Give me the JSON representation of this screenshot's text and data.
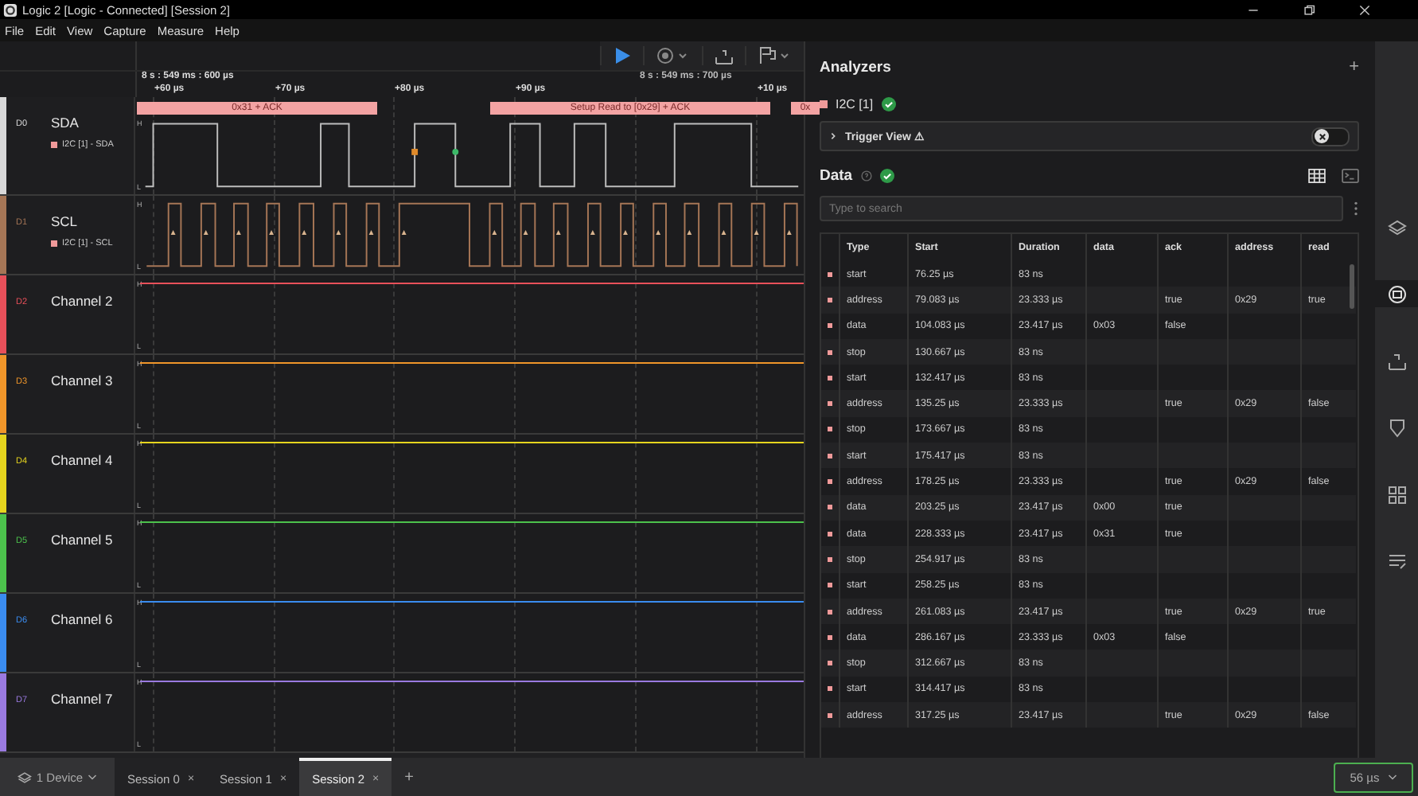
{
  "window": {
    "title": "Logic 2 [Logic - Connected] [Session 2]"
  },
  "menu": [
    "File",
    "Edit",
    "View",
    "Capture",
    "Measure",
    "Help"
  ],
  "timeline": {
    "origins": [
      "8 s : 549 ms : 600 µs",
      "8 s : 549 ms : 700 µs"
    ],
    "ticks": [
      "+60 µs",
      "+70 µs",
      "+80 µs",
      "+90 µs",
      "+10 µs"
    ]
  },
  "annotations": [
    "0x31 + ACK",
    "Setup Read to [0x29] + ACK",
    "0x"
  ],
  "channels": [
    {
      "id": "D0",
      "name": "SDA",
      "color": "#d8d8d8",
      "analyzer": "I2C [1] - SDA",
      "kind": "sda",
      "high": "H",
      "low": "L"
    },
    {
      "id": "D1",
      "name": "SCL",
      "color": "#a67656",
      "analyzer": "I2C [1] - SCL",
      "kind": "scl",
      "high": "H",
      "low": "L"
    },
    {
      "id": "D2",
      "name": "Channel 2",
      "color": "#e8505a",
      "kind": "flat",
      "high": "H",
      "low": "L"
    },
    {
      "id": "D3",
      "name": "Channel 3",
      "color": "#f0962a",
      "kind": "flat",
      "high": "H",
      "low": "L"
    },
    {
      "id": "D4",
      "name": "Channel 4",
      "color": "#e6d41e",
      "kind": "flat",
      "high": "H",
      "low": "L"
    },
    {
      "id": "D5",
      "name": "Channel 5",
      "color": "#4cc24c",
      "kind": "flat",
      "high": "H",
      "low": "L"
    },
    {
      "id": "D6",
      "name": "Channel 6",
      "color": "#3a8cf0",
      "kind": "flat",
      "high": "H",
      "low": "L"
    },
    {
      "id": "D7",
      "name": "Channel 7",
      "color": "#9a7ae0",
      "kind": "flat",
      "high": "H",
      "low": "L"
    }
  ],
  "analyzers": {
    "title": "Analyzers",
    "add": "+",
    "items": [
      {
        "name": "I2C [1]",
        "color": "#f09a9a",
        "ok": true
      }
    ],
    "trigger_view": {
      "label": "Trigger View ⚠",
      "on": false
    }
  },
  "data": {
    "title": "Data",
    "ok": true,
    "search": {
      "placeholder": "Type to search"
    },
    "columns": [
      "Type",
      "Start",
      "Duration",
      "data",
      "ack",
      "address",
      "read"
    ],
    "rows": [
      [
        "start",
        "76.25 µs",
        "83 ns",
        null,
        null,
        null,
        null
      ],
      [
        "address",
        "79.083 µs",
        "23.333 µs",
        null,
        "true",
        "0x29",
        "true"
      ],
      [
        "data",
        "104.083 µs",
        "23.417 µs",
        "0x03",
        "false",
        null,
        null
      ],
      [
        "stop",
        "130.667 µs",
        "83 ns",
        null,
        null,
        null,
        null
      ],
      [
        "start",
        "132.417 µs",
        "83 ns",
        null,
        null,
        null,
        null
      ],
      [
        "address",
        "135.25 µs",
        "23.333 µs",
        null,
        "true",
        "0x29",
        "false"
      ],
      [
        "stop",
        "173.667 µs",
        "83 ns",
        null,
        null,
        null,
        null
      ],
      [
        "start",
        "175.417 µs",
        "83 ns",
        null,
        null,
        null,
        null
      ],
      [
        "address",
        "178.25 µs",
        "23.333 µs",
        null,
        "true",
        "0x29",
        "false"
      ],
      [
        "data",
        "203.25 µs",
        "23.417 µs",
        "0x00",
        "true",
        null,
        null
      ],
      [
        "data",
        "228.333 µs",
        "23.417 µs",
        "0x31",
        "true",
        null,
        null
      ],
      [
        "stop",
        "254.917 µs",
        "83 ns",
        null,
        null,
        null,
        null
      ],
      [
        "start",
        "258.25 µs",
        "83 ns",
        null,
        null,
        null,
        null
      ],
      [
        "address",
        "261.083 µs",
        "23.417 µs",
        null,
        "true",
        "0x29",
        "true"
      ],
      [
        "data",
        "286.167 µs",
        "23.333 µs",
        "0x03",
        "false",
        null,
        null
      ],
      [
        "stop",
        "312.667 µs",
        "83 ns",
        null,
        null,
        null,
        null
      ],
      [
        "start",
        "314.417 µs",
        "83 ns",
        null,
        null,
        null,
        null
      ],
      [
        "address",
        "317.25 µs",
        "23.417 µs",
        null,
        "true",
        "0x29",
        "false"
      ]
    ]
  },
  "side_icons": [
    {
      "kind": "layers",
      "selected": false
    },
    {
      "kind": "analyzer",
      "selected": true
    },
    {
      "kind": "measure",
      "selected": false
    },
    {
      "kind": "marker",
      "selected": false
    },
    {
      "kind": "extensions",
      "selected": false
    },
    {
      "kind": "notes",
      "selected": false
    }
  ],
  "device": "1 Device",
  "tabs": [
    {
      "label": "Session 0",
      "close": "×",
      "selected": false
    },
    {
      "label": "Session 1",
      "close": "×",
      "selected": false
    },
    {
      "label": "Session 2",
      "close": "×",
      "selected": true
    }
  ],
  "add_tab": "+",
  "zoom": "56 µs"
}
